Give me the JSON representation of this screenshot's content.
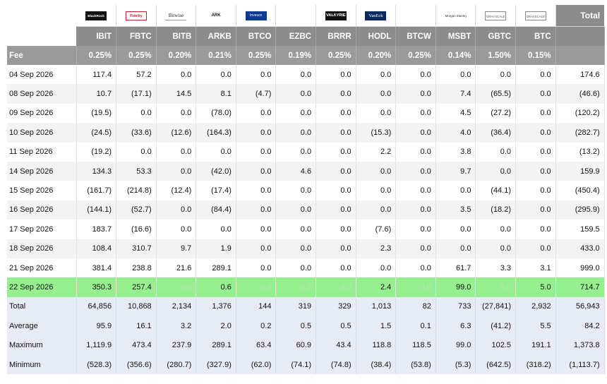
{
  "header": {
    "total_label": "Total",
    "fee_label": "Fee",
    "logos": [
      {
        "icon": "blackrock-logo",
        "text": "BlackRock"
      },
      {
        "icon": "fidelity-logo",
        "text": "Fidelity"
      },
      {
        "icon": "bitwise-logo",
        "text": "Bitwise"
      },
      {
        "icon": "ark-logo",
        "text": "ARK"
      },
      {
        "icon": "invesco-logo",
        "text": "Invesco"
      },
      {
        "icon": "franklin-logo",
        "text": ""
      },
      {
        "icon": "valkyrie-logo",
        "text": "VALKYRIE"
      },
      {
        "icon": "vaneck-logo",
        "text": "VanEck"
      },
      {
        "icon": "wisdomtree-logo",
        "text": ""
      },
      {
        "icon": "morgan-stanley-logo",
        "text": "Morgan Stanley"
      },
      {
        "icon": "grayscale-logo",
        "text": "GRAYSCALE"
      },
      {
        "icon": "grayscale-mini-logo",
        "text": "GRAYSCALE"
      }
    ],
    "tickers": [
      "IBIT",
      "FBTC",
      "BITB",
      "ARKB",
      "BTCO",
      "EZBC",
      "BRRR",
      "HODL",
      "BTCW",
      "MSBT",
      "GBTC",
      "BTC"
    ],
    "fees": [
      "0.25%",
      "0.25%",
      "0.20%",
      "0.21%",
      "0.25%",
      "0.19%",
      "0.25%",
      "0.20%",
      "0.25%",
      "0.14%",
      "1.50%",
      "0.15%"
    ]
  },
  "rows": [
    {
      "date": "04 Sep 2026",
      "values": [
        "117.4",
        "57.2",
        "0.0",
        "0.0",
        "0.0",
        "0.0",
        "0.0",
        "0.0",
        "0.0",
        "0.0",
        "0.0",
        "0.0"
      ],
      "total": "174.6"
    },
    {
      "date": "08 Sep 2026",
      "values": [
        "10.7",
        "(17.1)",
        "14.5",
        "8.1",
        "(4.7)",
        "0.0",
        "0.0",
        "0.0",
        "0.0",
        "7.4",
        "(65.5)",
        "0.0"
      ],
      "total": "(46.6)"
    },
    {
      "date": "09 Sep 2026",
      "values": [
        "(19.5)",
        "0.0",
        "0.0",
        "(78.0)",
        "0.0",
        "0.0",
        "0.0",
        "0.0",
        "0.0",
        "4.5",
        "(27.2)",
        "0.0"
      ],
      "total": "(120.2)"
    },
    {
      "date": "10 Sep 2026",
      "values": [
        "(24.5)",
        "(33.6)",
        "(12.6)",
        "(164.3)",
        "0.0",
        "0.0",
        "0.0",
        "(15.3)",
        "0.0",
        "4.0",
        "(36.4)",
        "0.0"
      ],
      "total": "(282.7)"
    },
    {
      "date": "11 Sep 2026",
      "values": [
        "(19.2)",
        "0.0",
        "0.0",
        "0.0",
        "0.0",
        "0.0",
        "0.0",
        "2.2",
        "0.0",
        "3.8",
        "0.0",
        "0.0"
      ],
      "total": "(13.2)"
    },
    {
      "date": "14 Sep 2026",
      "values": [
        "134.3",
        "53.3",
        "0.0",
        "(42.0)",
        "0.0",
        "4.6",
        "0.0",
        "0.0",
        "0.0",
        "9.7",
        "0.0",
        "0.0"
      ],
      "total": "159.9"
    },
    {
      "date": "15 Sep 2026",
      "values": [
        "(161.7)",
        "(214.8)",
        "(12.4)",
        "(17.4)",
        "0.0",
        "0.0",
        "0.0",
        "0.0",
        "0.0",
        "0.0",
        "(44.1)",
        "0.0"
      ],
      "total": "(450.4)"
    },
    {
      "date": "16 Sep 2026",
      "values": [
        "(144.1)",
        "(52.7)",
        "0.0",
        "(84.4)",
        "0.0",
        "0.0",
        "0.0",
        "0.0",
        "0.0",
        "3.5",
        "(18.2)",
        "0.0"
      ],
      "total": "(295.9)"
    },
    {
      "date": "17 Sep 2026",
      "values": [
        "183.7",
        "(16.6)",
        "0.0",
        "0.0",
        "0.0",
        "0.0",
        "0.0",
        "(7.6)",
        "0.0",
        "0.0",
        "0.0",
        "0.0"
      ],
      "total": "159.5"
    },
    {
      "date": "18 Sep 2026",
      "values": [
        "108.4",
        "310.7",
        "9.7",
        "1.9",
        "0.0",
        "0.0",
        "0.0",
        "2.3",
        "0.0",
        "0.0",
        "0.0",
        "0.0"
      ],
      "total": "433.0"
    },
    {
      "date": "21 Sep 2026",
      "values": [
        "381.4",
        "238.8",
        "21.6",
        "289.1",
        "0.0",
        "0.0",
        "0.0",
        "0.0",
        "0.0",
        "61.7",
        "3.3",
        "3.1"
      ],
      "total": "999.0"
    },
    {
      "date": "22 Sep 2026",
      "values": [
        "350.3",
        "257.4",
        "0.0",
        "0.6",
        "0.0",
        "0.0",
        "0.0",
        "2.4",
        "0.0",
        "99.0",
        "0.0",
        "5.0"
      ],
      "total": "714.7",
      "highlight": true
    }
  ],
  "stats": [
    {
      "label": "Total",
      "values": [
        "64,856",
        "10,868",
        "2,134",
        "1,376",
        "144",
        "319",
        "329",
        "1,013",
        "82",
        "733",
        "(27,841)",
        "2,932"
      ],
      "total": "56,943"
    },
    {
      "label": "Average",
      "values": [
        "95.9",
        "16.1",
        "3.2",
        "2.0",
        "0.2",
        "0.5",
        "0.5",
        "1.5",
        "0.1",
        "6.3",
        "(41.2)",
        "5.5"
      ],
      "total": "84.2"
    },
    {
      "label": "Maximum",
      "values": [
        "1,119.9",
        "473.4",
        "237.9",
        "289.1",
        "63.4",
        "60.9",
        "43.4",
        "118.8",
        "118.5",
        "99.0",
        "102.5",
        "191.1"
      ],
      "total": "1,373.8"
    },
    {
      "label": "Minimum",
      "values": [
        "(528.3)",
        "(356.6)",
        "(280.7)",
        "(327.9)",
        "(62.0)",
        "(74.1)",
        "(74.8)",
        "(38.4)",
        "(53.8)",
        "(5.3)",
        "(642.5)",
        "(318.2)"
      ],
      "total": "(1,113.7)"
    }
  ],
  "colors": {
    "header_bg": "#8c8c8c",
    "fee_bg": "#9a9a9a",
    "negative": "#d9262c",
    "zero": "#c6c6c6",
    "highlight_row": "#97f08f",
    "stats_bg": "#e6ebf6",
    "alt_row": "#f3f3f3"
  }
}
